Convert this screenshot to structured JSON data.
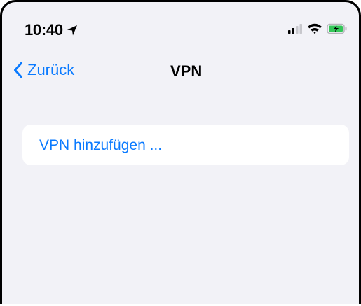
{
  "status_bar": {
    "time": "10:40",
    "location_icon": "location-arrow-icon",
    "signal_icon": "cellular-signal-icon",
    "wifi_icon": "wifi-icon",
    "battery_icon": "battery-charging-icon"
  },
  "nav": {
    "back_label": "Zurück",
    "back_icon": "chevron-left-icon",
    "title": "VPN"
  },
  "main": {
    "add_vpn_label": "VPN hinzufügen ..."
  },
  "colors": {
    "accent": "#0a7aff",
    "background": "#f2f2f7",
    "card": "#ffffff",
    "battery": "#34c759"
  }
}
